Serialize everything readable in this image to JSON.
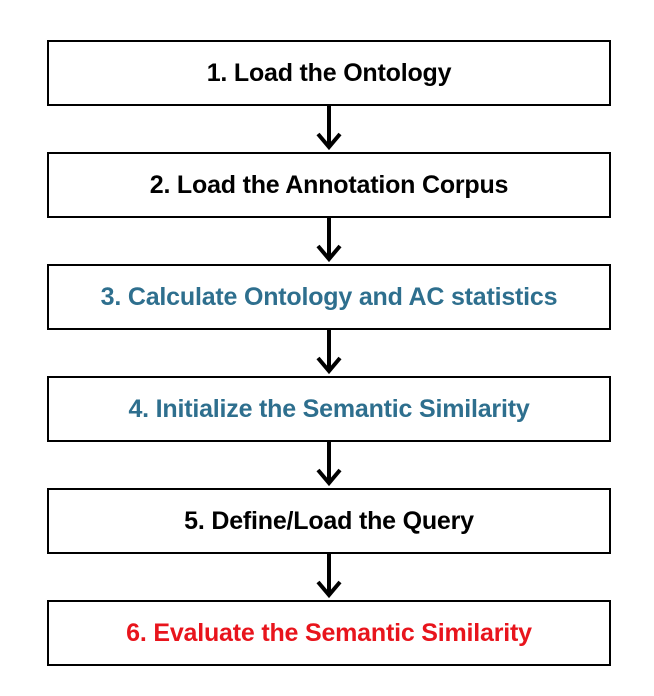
{
  "colors": {
    "default_text": "#000000",
    "highlight_blue": "#2e6f8e",
    "highlight_red": "#e8141c",
    "border": "#000000",
    "arrow": "#000000"
  },
  "steps": [
    {
      "label": "1. Load the Ontology",
      "color": "#000000"
    },
    {
      "label": "2. Load the Annotation Corpus",
      "color": "#000000"
    },
    {
      "label": "3. Calculate Ontology and AC statistics",
      "color": "#2e6f8e"
    },
    {
      "label": "4. Initialize the Semantic Similarity",
      "color": "#2e6f8e"
    },
    {
      "label": "5. Define/Load the Query",
      "color": "#000000"
    },
    {
      "label": "6. Evaluate the Semantic Similarity",
      "color": "#e8141c"
    }
  ]
}
